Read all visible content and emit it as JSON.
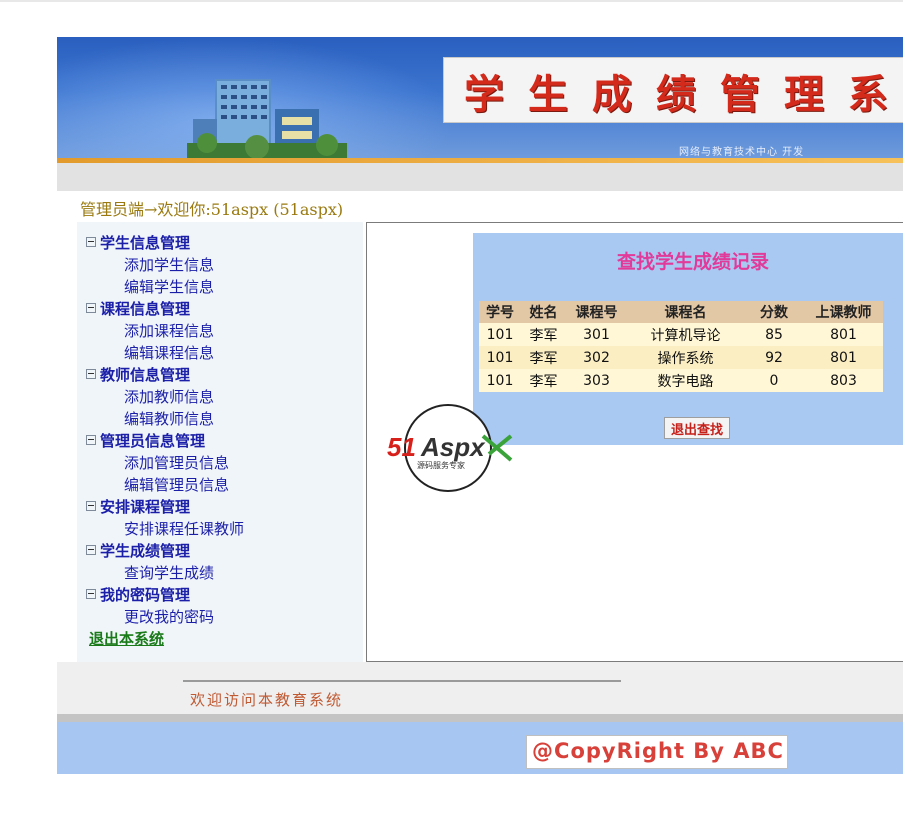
{
  "header": {
    "title": "学生成绩管理系",
    "developer": "网络与教育技术中心 开发"
  },
  "welcome_text": "管理员端→欢迎你:51aspx (51aspx)",
  "sidebar": {
    "groups": [
      {
        "label": "学生信息管理",
        "items": [
          "添加学生信息",
          "编辑学生信息"
        ]
      },
      {
        "label": "课程信息管理",
        "items": [
          "添加课程信息",
          "编辑课程信息"
        ]
      },
      {
        "label": "教师信息管理",
        "items": [
          "添加教师信息",
          "编辑教师信息"
        ]
      },
      {
        "label": "管理员信息管理",
        "items": [
          "添加管理员信息",
          "编辑管理员信息"
        ]
      },
      {
        "label": "安排课程管理",
        "items": [
          "安排课程任课教师"
        ]
      },
      {
        "label": "学生成绩管理",
        "items": [
          "查询学生成绩"
        ]
      },
      {
        "label": "我的密码管理",
        "items": [
          "更改我的密码"
        ]
      }
    ],
    "exit_link": "退出本系统"
  },
  "search": {
    "title": "查找学生成绩记录",
    "columns": [
      "学号",
      "姓名",
      "课程号",
      "课程名",
      "分数",
      "上课教师"
    ],
    "rows": [
      [
        "101",
        "李军",
        "301",
        "计算机导论",
        "85",
        "801"
      ],
      [
        "101",
        "李军",
        "302",
        "操作系统",
        "92",
        "801"
      ],
      [
        "101",
        "李军",
        "303",
        "数字电路",
        "0",
        "803"
      ]
    ],
    "exit_button": "退出查找"
  },
  "logo": {
    "text": "51Aspx",
    "subtitle": "源码服务专家"
  },
  "footer": {
    "welcome": "欢迎访问本教育系统",
    "copyright": "@CopyRight By ABC"
  },
  "colors": {
    "banner_blue": "#2a5fbf",
    "title_red": "#d42a1c",
    "menu_blue": "#1b1fa8",
    "search_bg": "#a9c9f2",
    "search_title": "#e23a9a"
  }
}
